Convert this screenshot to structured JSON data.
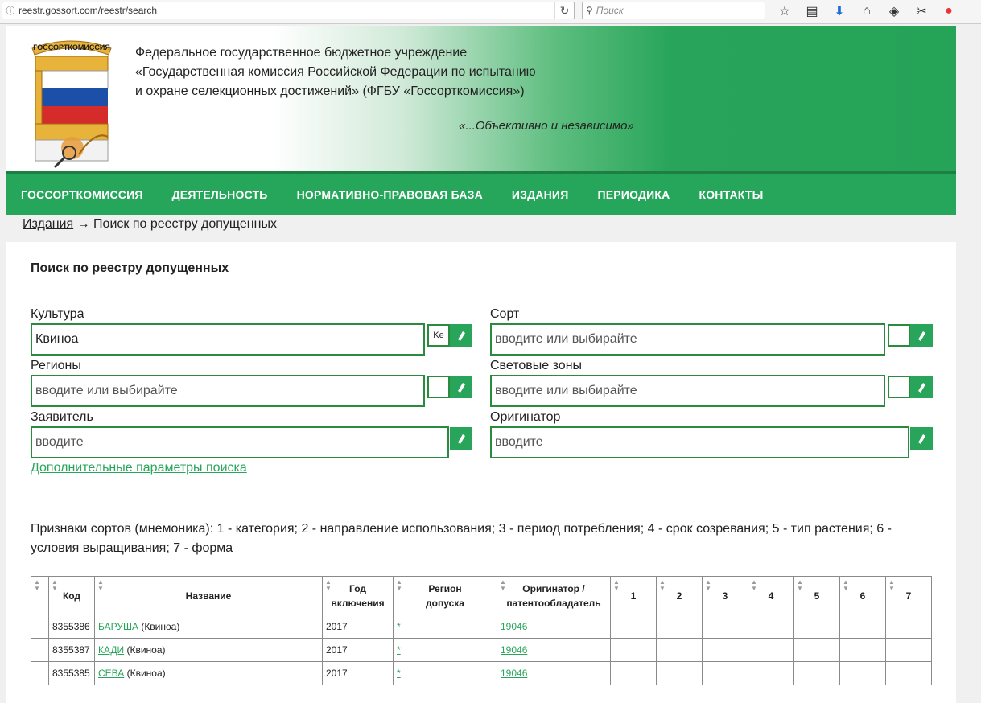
{
  "browser": {
    "url": "reestr.gossort.com/reestr/search",
    "search_placeholder": "Поиск"
  },
  "header": {
    "logo_text": "ГОССОРТКОМИССИЯ",
    "org_line1": "Федеральное государственное бюджетное учреждение",
    "org_line2": "«Государственная комиссия Российской Федерации по испытанию",
    "org_line3": "и охране селекционных достижений» (ФГБУ «Госсорткомиссия»)",
    "motto": "«...Объективно и независимо»"
  },
  "nav": {
    "items": [
      "ГОССОРТКОМИССИЯ",
      "ДЕЯТЕЛЬНОСТЬ",
      "НОРМАТИВНО-ПРАВОВАЯ БАЗА",
      "ИЗДАНИЯ",
      "ПЕРИОДИКА",
      "КОНТАКТЫ"
    ]
  },
  "breadcrumb": {
    "link": "Издания",
    "separator": " → ",
    "current": "Поиск по реестру допущенных"
  },
  "form": {
    "title": "Поиск по реестру допущенных",
    "culture_label": "Культура",
    "culture_value": "Квиноа",
    "culture_code": "Ke",
    "sort_label": "Сорт",
    "sort_placeholder": "вводите или выбирайте",
    "regions_label": "Регионы",
    "regions_placeholder": "вводите или выбирайте",
    "zones_label": "Световые зоны",
    "zones_placeholder": "вводите или выбирайте",
    "applicant_label": "Заявитель",
    "applicant_placeholder": "вводите",
    "originator_label": "Оригинатор",
    "originator_placeholder": "вводите",
    "advanced_link": "Дополнительные параметры поиска"
  },
  "legend": "Признаки сортов (мнемоника): 1 - категория; 2 - направление использования; 3 - период потребления; 4 - срок созревания; 5 - тип растения; 6 - условия выращивания; 7 - форма",
  "table": {
    "headers": {
      "code": "Код",
      "name": "Название",
      "year_l1": "Год",
      "year_l2": "включения",
      "region_l1": "Регион",
      "region_l2": "допуска",
      "orig_l1": "Оригинатор /",
      "orig_l2": "патентообладатель",
      "c1": "1",
      "c2": "2",
      "c3": "3",
      "c4": "4",
      "c5": "5",
      "c6": "6",
      "c7": "7"
    },
    "rows": [
      {
        "code": "8355386",
        "name_link": "БАРУША",
        "name_suffix": " (Квиноа)",
        "year": "2017",
        "region": "*",
        "originator": "19046"
      },
      {
        "code": "8355387",
        "name_link": "КАДИ",
        "name_suffix": " (Квиноа)",
        "year": "2017",
        "region": "*",
        "originator": "19046"
      },
      {
        "code": "8355385",
        "name_link": "СЕВА",
        "name_suffix": " (Квиноа)",
        "year": "2017",
        "region": "*",
        "originator": "19046"
      }
    ]
  },
  "colors": {
    "brand_green": "#26a65b",
    "border_green": "#2a8a3e",
    "link_green": "#28a55a"
  }
}
